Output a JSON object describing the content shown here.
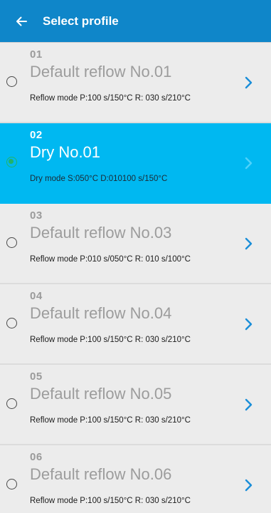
{
  "header": {
    "title": "Select profile",
    "background": "#0f86c9"
  },
  "profiles": [
    {
      "number": "01",
      "name": "Default reflow No.01",
      "description": "Reflow mode P:100 s/150°C   R: 030 s/210°C",
      "selected": false
    },
    {
      "number": "02",
      "name": "Dry No.01",
      "description": "Dry mode S:050°C   D:010100 s/150°C",
      "selected": true
    },
    {
      "number": "03",
      "name": "Default reflow No.03",
      "description": "Reflow mode P:010 s/050°C   R: 010 s/100°C",
      "selected": false
    },
    {
      "number": "04",
      "name": "Default reflow No.04",
      "description": "Reflow mode P:100 s/150°C   R: 030 s/210°C",
      "selected": false
    },
    {
      "number": "05",
      "name": "Default reflow No.05",
      "description": "Reflow mode P:100 s/150°C   R: 030 s/210°C",
      "selected": false
    },
    {
      "number": "06",
      "name": "Default reflow No.06",
      "description": "Reflow mode P:100 s/150°C   R: 030 s/210°C",
      "selected": false
    }
  ],
  "colors": {
    "selected_row": "#00b8f1",
    "radio_selected": "#21b36a",
    "chevron": "#1a8ed8"
  },
  "icons": {
    "back": "back-arrow-icon",
    "radio": "radio-button-icon",
    "chevron": "chevron-right-icon"
  }
}
